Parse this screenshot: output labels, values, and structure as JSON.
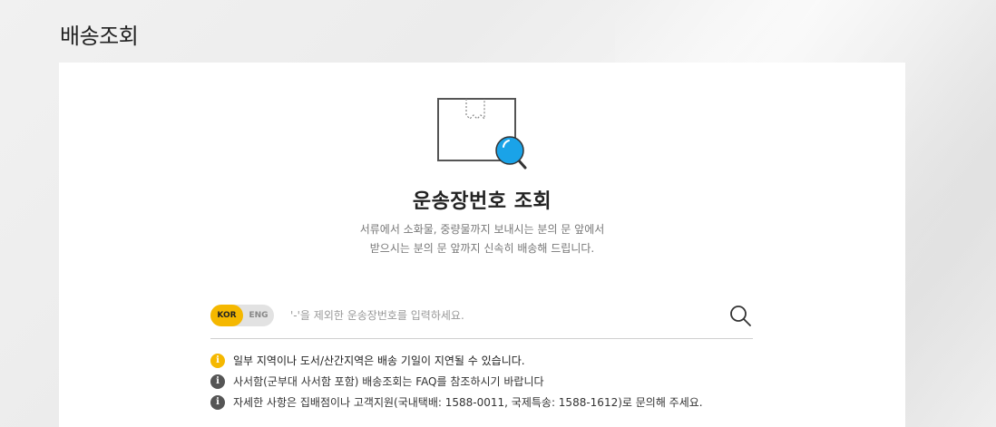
{
  "page": {
    "title": "배송조회"
  },
  "tracking": {
    "heading": "운송장번호 조회",
    "description_line1": "서류에서 소화물, 중량물까지 보내시는 분의 문 앞에서",
    "description_line2": "받으시는 분의 문 앞까지 신속히 배송해 드립니다.",
    "illustration_icon": "box-with-magnifier-icon"
  },
  "search": {
    "lang_kor": "KOR",
    "lang_eng": "ENG",
    "selected_lang": "KOR",
    "placeholder": "'-'을 제외한 운송장번호를 입력하세요.",
    "value": "",
    "button_icon": "search-icon"
  },
  "notices": [
    {
      "type": "warning",
      "icon": "warning-icon",
      "text": "일부 지역이나 도서/산간지역은 배송 기일이 지연될 수 있습니다."
    },
    {
      "type": "info",
      "icon": "info-icon",
      "text": "사서함(군부대 사서함 포함) 배송조회는 FAQ를 참조하시기 바랍니다"
    },
    {
      "type": "info",
      "icon": "info-icon",
      "text": "자세한 사항은 집배점이나 고객지원(국내택배: 1588-0011, 국제특송: 1588-1612)로 문의해 주세요."
    }
  ],
  "colors": {
    "accent": "#f5b800",
    "magnifier": "#1aa3e8",
    "info_icon": "#555555"
  }
}
